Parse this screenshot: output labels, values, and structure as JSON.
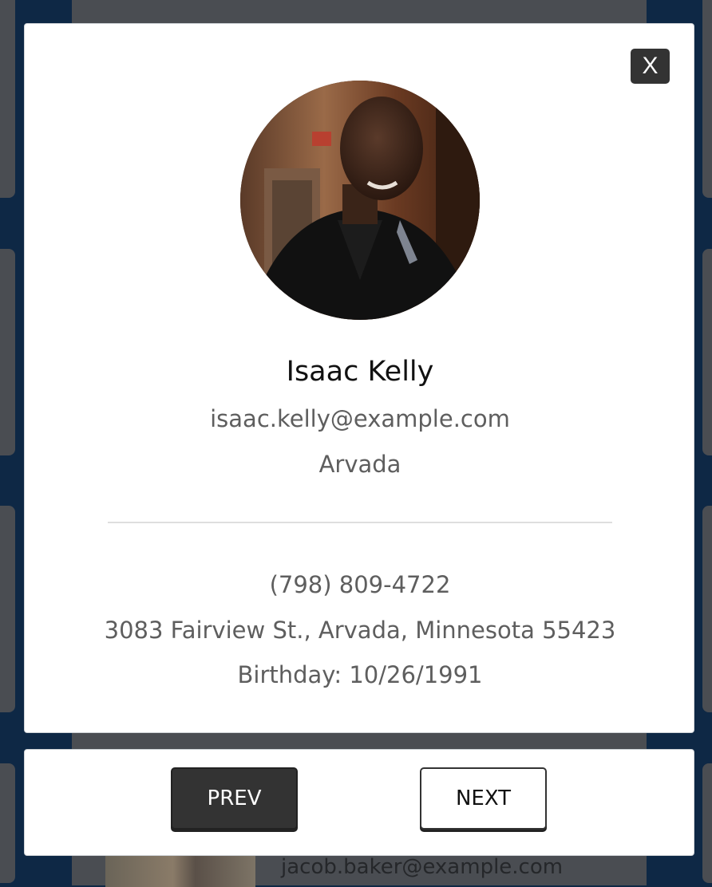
{
  "modal": {
    "close_label": "X",
    "user": {
      "name": "Isaac Kelly",
      "email": "isaac.kelly@example.com",
      "city": "Arvada",
      "phone": "(798) 809-4722",
      "address": "3083 Fairview St., Arvada, Minnesota 55423",
      "birthday": "Birthday: 10/26/1991"
    }
  },
  "navigation": {
    "prev_label": "PREV",
    "next_label": "NEXT"
  },
  "background": {
    "next_card_email": "jacob.baker@example.com"
  },
  "colors": {
    "page_background": "#0e2845",
    "button_dark": "#333333",
    "text_muted": "#5e5e5e"
  }
}
